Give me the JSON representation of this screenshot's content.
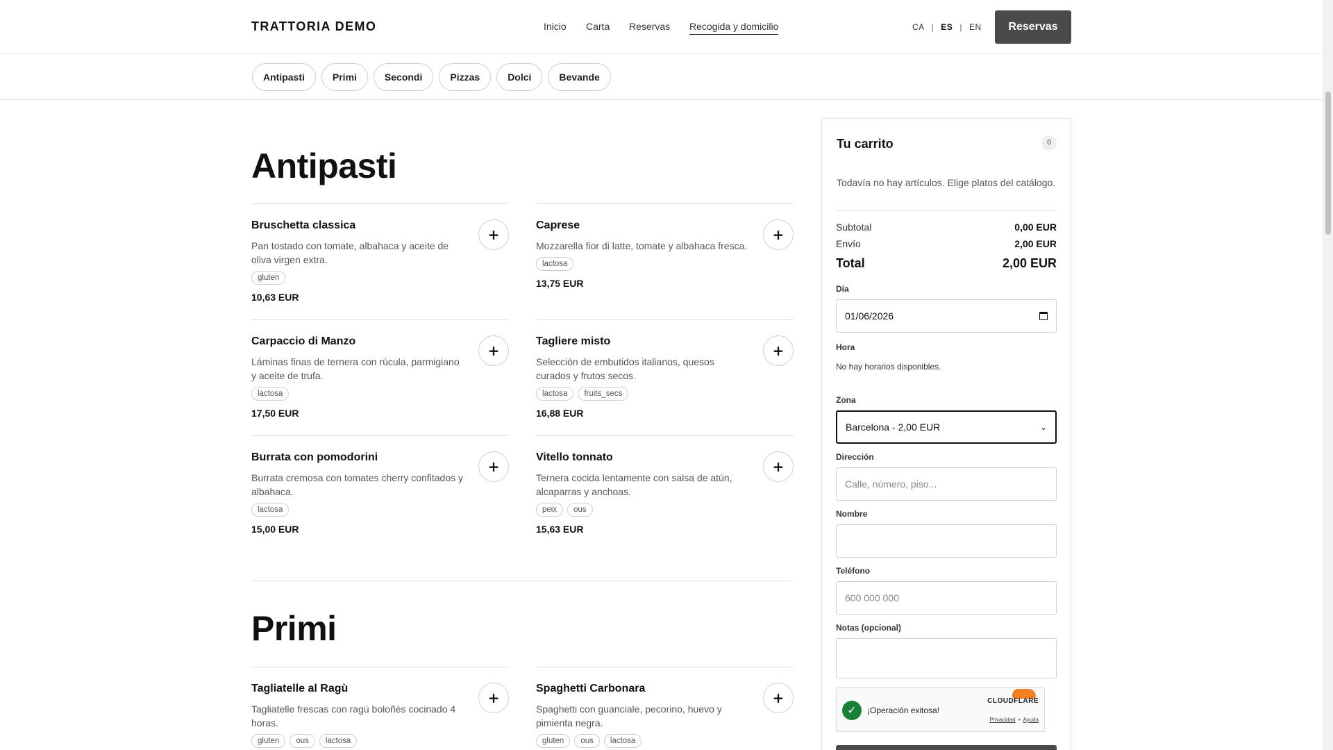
{
  "header": {
    "brand": "TRATTORIA DEMO",
    "nav": [
      "Inicio",
      "Carta",
      "Reservas",
      "Recogida y domicilio"
    ],
    "langs": {
      "ca": "CA",
      "es": "ES",
      "en": "EN",
      "sep": "|"
    },
    "reserve_button": "Reservas"
  },
  "categories": [
    "Antipasti",
    "Primi",
    "Secondi",
    "Pizzas",
    "Dolci",
    "Bevande"
  ],
  "sections": {
    "antipasti": {
      "title": "Antipasti",
      "items": [
        {
          "name": "Bruschetta classica",
          "desc": "Pan tostado con tomate, albahaca y aceite de oliva virgen extra.",
          "tags": [
            "gluten"
          ],
          "price": "10,63 EUR"
        },
        {
          "name": "Caprese",
          "desc": "Mozzarella fior di latte, tomate y albahaca fresca.",
          "tags": [
            "lactosa"
          ],
          "price": "13,75 EUR"
        },
        {
          "name": "Carpaccio di Manzo",
          "desc": "Láminas finas de ternera con rúcula, parmigiano y aceite de trufa.",
          "tags": [
            "lactosa"
          ],
          "price": "17,50 EUR"
        },
        {
          "name": "Tagliere misto",
          "desc": "Selección de embutidos italianos, quesos curados y frutos secos.",
          "tags": [
            "lactosa",
            "fruits_secs"
          ],
          "price": "16,88 EUR"
        },
        {
          "name": "Burrata con pomodorini",
          "desc": "Burrata cremosa con tomates cherry confitados y albahaca.",
          "tags": [
            "lactosa"
          ],
          "price": "15,00 EUR"
        },
        {
          "name": "Vitello tonnato",
          "desc": "Ternera cocida lentamente con salsa de atún, alcaparras y anchoas.",
          "tags": [
            "peix",
            "ous"
          ],
          "price": "15,63 EUR"
        }
      ]
    },
    "primi": {
      "title": "Primi",
      "items": [
        {
          "name": "Tagliatelle al Ragù",
          "desc": "Tagliatelle frescas con ragú boloñés cocinado 4 horas.",
          "tags": [
            "gluten",
            "ous",
            "lactosa"
          ]
        },
        {
          "name": "Spaghetti Carbonara",
          "desc": "Spaghetti con guanciale, pecorino, huevo y pimienta negra.",
          "tags": [
            "gluten",
            "ous",
            "lactosa"
          ]
        }
      ]
    }
  },
  "add_symbol": "+",
  "cart": {
    "title": "Tu carrito",
    "count": "0",
    "empty_text": "Todavía no hay artículos. Elige platos del catálogo.",
    "subtotal_label": "Subtotal",
    "subtotal_value": "0,00 EUR",
    "shipping_label": "Envío",
    "shipping_value": "2,00 EUR",
    "total_label": "Total",
    "total_value": "2,00 EUR",
    "day_label": "Día",
    "day_value": "01/06/2026",
    "hour_label": "Hora",
    "no_hours": "No hay horarios disponibles.",
    "zone_label": "Zona",
    "zone_value": "Barcelona - 2,00 EUR",
    "address_label": "Dirección",
    "address_placeholder": "Calle, número, piso...",
    "name_label": "Nombre",
    "phone_label": "Teléfono",
    "phone_placeholder": "600 000 000",
    "notes_label": "Notas (opcional)",
    "captcha_text": "¡Operación exitosa!",
    "captcha_brand": "CLOUDFLARE",
    "captcha_privacy": "Privacidad",
    "captcha_sep": "•",
    "captcha_help": "Ayuda"
  },
  "colors": {
    "primary_button": "#4a4a4a",
    "success": "#1a7f37",
    "cloudflare": "#f38020"
  }
}
